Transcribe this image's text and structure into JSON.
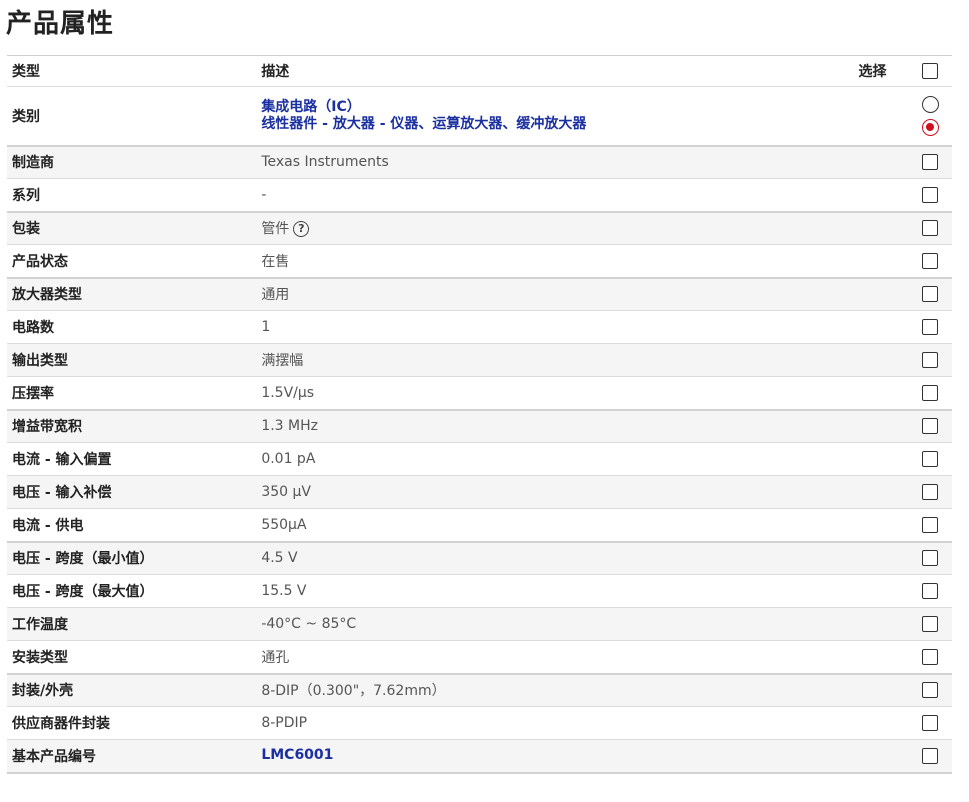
{
  "page": {
    "title": "产品属性"
  },
  "table": {
    "headers": {
      "type": "类型",
      "description": "描述",
      "select": "选择"
    },
    "rows": [
      {
        "type": "类别",
        "links": [
          "集成电路（IC）",
          "线性器件 - 放大器 - 仪器、运算放大器、缓冲放大器"
        ],
        "control": "radio",
        "radio_selected_index": 1
      },
      {
        "type": "制造商",
        "value": "Texas Instruments"
      },
      {
        "type": "系列",
        "value": "-"
      },
      {
        "type": "包装",
        "value": "管件",
        "help_icon": "question-circle-icon"
      },
      {
        "type": "产品状态",
        "value": "在售"
      },
      {
        "type": "放大器类型",
        "value": "通用"
      },
      {
        "type": "电路数",
        "value": "1"
      },
      {
        "type": "输出类型",
        "value": "满摆幅"
      },
      {
        "type": "压摆率",
        "value": "1.5V/µs"
      },
      {
        "type": "增益带宽积",
        "value": "1.3 MHz"
      },
      {
        "type": "电流 - 输入偏置",
        "value": "0.01 pA"
      },
      {
        "type": "电压 - 输入补偿",
        "value": "350 µV"
      },
      {
        "type": "电流 - 供电",
        "value": "550µA"
      },
      {
        "type": "电压 - 跨度（最小值）",
        "value": "4.5 V"
      },
      {
        "type": "电压 - 跨度（最大值）",
        "value": "15.5 V"
      },
      {
        "type": "工作温度",
        "value": "-40°C ~ 85°C"
      },
      {
        "type": "安装类型",
        "value": "通孔"
      },
      {
        "type": "封装/外壳",
        "value": "8-DIP（0.300\"，7.62mm）"
      },
      {
        "type": "供应商器件封装",
        "value": "8-PDIP"
      },
      {
        "type": "基本产品编号",
        "value": "LMC6001",
        "is_link": true
      }
    ]
  },
  "colors": {
    "link": "#1a2fa0",
    "radio_selected": "#d0101b",
    "row_alt_bg": "#f5f5f5"
  }
}
